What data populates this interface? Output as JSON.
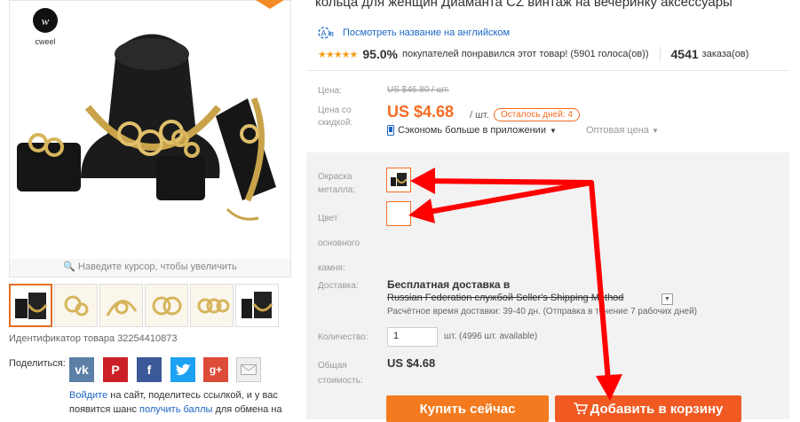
{
  "product": {
    "title": "кольца для женщин Диаманта CZ винтаж на вечеринку аксессуары",
    "translate_link": "Посмотреть название на английском",
    "rating_stars": "★★★★★",
    "rating_percent": "95.0%",
    "rating_text": "покупателей понравился этот товар! (5901 голоса(ов))",
    "orders_count": "4541",
    "orders_label": "заказа(ов)",
    "brand_logo_text": "cweel",
    "zoom_hint": "Наведите курсор, чтобы увеличить",
    "product_id": "Идентификатор товара 32254410873",
    "icons": {
      "translate": "translate-icon",
      "zoom": "magnifier-icon",
      "phone": "phone-icon",
      "cart": "cart-icon"
    }
  },
  "price": {
    "label": "Цена:",
    "old": "US $46.80 / шт.",
    "discount_label": "Цена со скидкой:",
    "new": "US $4.68",
    "unit": "/ шт.",
    "days_left": "Осталось дней: 4",
    "app_promo": "Сэкономь больше в приложении",
    "wholesale": "Оптовая цена",
    "accent_color": "#f36c21"
  },
  "options": {
    "metal_color_label": "Окраска металла:",
    "stone_color_label": "Цвет основного камня:"
  },
  "shipping": {
    "label": "Доставка:",
    "title": "Бесплатная доставка в",
    "method": "Russian Federation службой Seller's Shipping Method",
    "time": "Расчётное время доставки: 39-40 дн. (Отправка в течение 7 рабочих дней)"
  },
  "quantity": {
    "label": "Количество:",
    "value": "1",
    "available": "шт. (4996 шт. available)"
  },
  "total": {
    "label": "Общая стоимость:",
    "value": "US $4.68"
  },
  "buttons": {
    "buy_now": "Купить сейчас",
    "add_to_cart": "Добавить в корзину"
  },
  "share": {
    "label": "Поделиться:",
    "networks": [
      "vk",
      "pinterest",
      "facebook",
      "twitter",
      "google-plus",
      "email"
    ],
    "text_pre": " на сайт, поделитесь ссылкой, и у вас появится шанс ",
    "login_link": "Войдите",
    "points_link": "получить баллы",
    "text_post": " для обмена на"
  },
  "annotation": {
    "arrow_color": "#ff0000"
  }
}
